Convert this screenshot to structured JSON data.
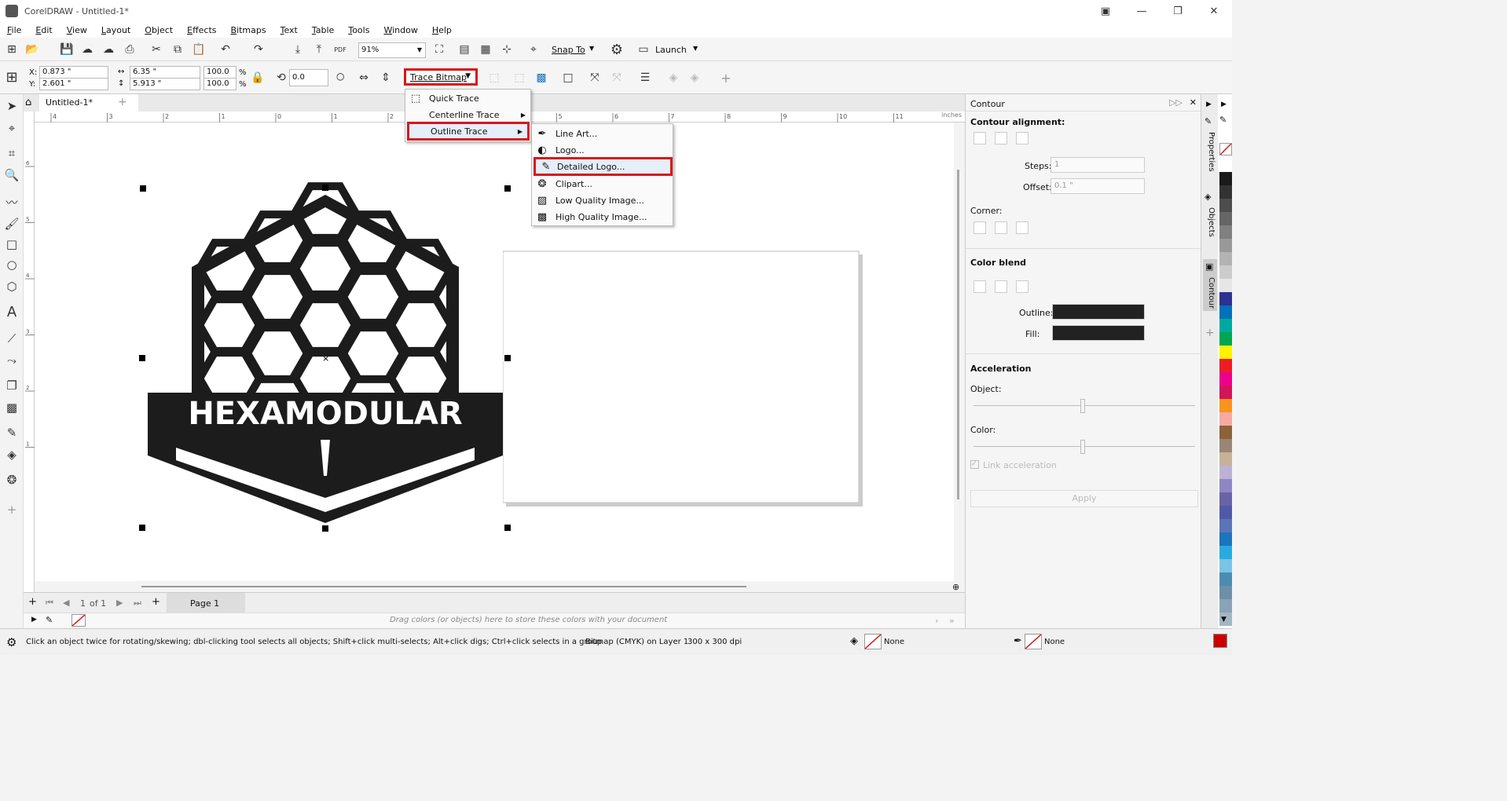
{
  "window": {
    "title": "CorelDRAW - Untitled-1*"
  },
  "menubar": [
    "File",
    "Edit",
    "View",
    "Layout",
    "Object",
    "Effects",
    "Bitmaps",
    "Text",
    "Table",
    "Tools",
    "Window",
    "Help"
  ],
  "toolbar": {
    "zoom": "91%",
    "snap_label": "Snap To",
    "launch_label": "Launch"
  },
  "propertybar": {
    "x_label": "X:",
    "x_value": "0.873 \"",
    "y_label": "Y:",
    "y_value": "2.601 \"",
    "width_value": "6.35 \"",
    "height_value": "5.913 \"",
    "scale_w": "100.0",
    "scale_h": "100.0",
    "pct": "%",
    "rotation": "0.0",
    "trace_bitmap_label": "Trace Bitmap"
  },
  "trace_menu": [
    {
      "label": "Quick Trace",
      "icon": "quick-trace-icon"
    },
    {
      "label": "Centerline Trace",
      "icon": "",
      "submenu": true
    },
    {
      "label": "Outline Trace",
      "icon": "",
      "submenu": true,
      "highlight": true
    }
  ],
  "outline_submenu": [
    {
      "label": "Line Art...",
      "icon": "line-art-icon"
    },
    {
      "label": "Logo...",
      "icon": "logo-icon"
    },
    {
      "label": "Detailed Logo...",
      "icon": "detailed-logo-icon",
      "highlight": true
    },
    {
      "label": "Clipart...",
      "icon": "clipart-icon"
    },
    {
      "label": "Low Quality Image...",
      "icon": "low-quality-image-icon"
    },
    {
      "label": "High Quality Image...",
      "icon": "high-quality-image-icon"
    }
  ],
  "doc_tab": "Untitled-1*",
  "ruler": {
    "units": "inches",
    "h_ticks": [
      "4",
      "3",
      "2",
      "1",
      "0",
      "1",
      "2",
      "3",
      "4",
      "5",
      "6",
      "7",
      "8",
      "9",
      "10",
      "11"
    ],
    "v_ticks": [
      "6",
      "5",
      "4",
      "3",
      "2",
      "1"
    ]
  },
  "logo_text": "HEXAMODULAR",
  "pagebar": {
    "page_of": "1",
    "of_label": "of 1",
    "page_tab": "Page 1"
  },
  "colordock_hint": "Drag colors (or objects) here to store these colors with your document",
  "status": {
    "hint": "Click an object twice for rotating/skewing; dbl-clicking tool selects all objects; Shift+click multi-selects; Alt+click digs; Ctrl+click selects in a group",
    "object_info": "Bitmap (CMYK) on Layer 1",
    "dpi": "300 x 300 dpi",
    "fill_label": "None",
    "outline_label": "None"
  },
  "contour_panel": {
    "title": "Contour",
    "alignment_heading": "Contour alignment:",
    "steps_label": "Steps:",
    "steps_value": "1",
    "offset_label": "Offset:",
    "offset_value": "0.1 \"",
    "corner_label": "Corner:",
    "blend_heading": "Color blend",
    "outline_label": "Outline:",
    "fill_label": "Fill:",
    "accel_heading": "Acceleration",
    "object_label": "Object:",
    "color_label": "Color:",
    "link_label": "Link acceleration",
    "apply_label": "Apply"
  },
  "docker_tabs": [
    "Properties",
    "Objects",
    "Contour"
  ],
  "palette": [
    "#ffffff",
    "#1a1a1a",
    "#333333",
    "#4d4d4d",
    "#666666",
    "#808080",
    "#999999",
    "#b3b3b3",
    "#cccccc",
    "#e6e6e6",
    "#2e3192",
    "#0071bc",
    "#00a99d",
    "#00a651",
    "#fff200",
    "#ed1c24",
    "#ec008c",
    "#d4145a",
    "#f7941d",
    "#f5a9a0",
    "#8c6239",
    "#998675",
    "#c7b299",
    "#bcb2d6",
    "#8f86c4",
    "#6a63a8",
    "#4f5aa6",
    "#5b74b8",
    "#1b75bc",
    "#29abe2",
    "#7ac4e6",
    "#4c8cb0",
    "#6d8fa8",
    "#8aa3b8",
    "#a4b6c4"
  ],
  "colors": {
    "accent_red": "#d9151b",
    "logo_black": "#1c1c1c"
  }
}
